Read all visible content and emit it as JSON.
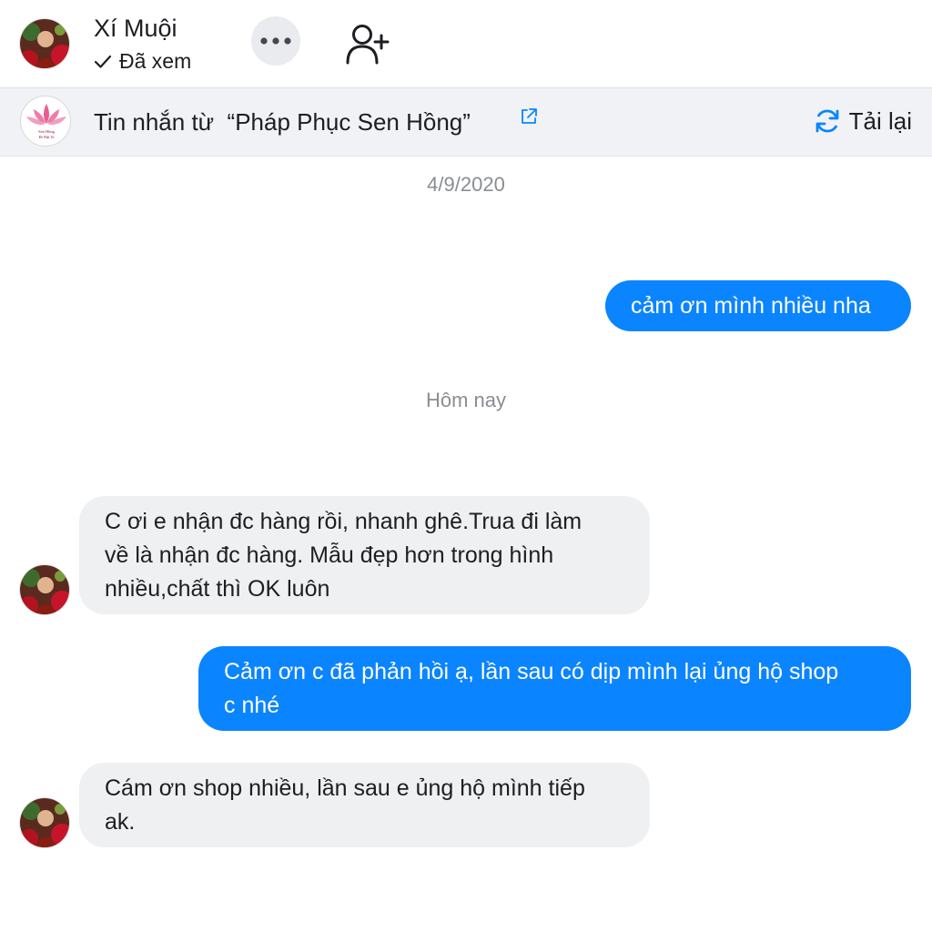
{
  "header": {
    "contact_name": "Xí Muội",
    "seen_status": "Đã xem",
    "icons": {
      "more": "more-horizontal-icon",
      "add_user": "add-user-icon",
      "seen": "checkmark-icon"
    }
  },
  "banner": {
    "prefix": "Tin nhắn từ",
    "page_name": "“Pháp Phục Sen Hồng”",
    "logo_text": [
      "Sen Hồng",
      "Đồ Phật Tử"
    ],
    "reload_label": "Tải lại",
    "icons": {
      "external": "external-link-icon",
      "reload": "reload-icon"
    }
  },
  "colors": {
    "accent": "#0b84ff",
    "incoming_bubble": "#eff0f2",
    "banner_bg": "#f0f2f5",
    "lotus": "#e85d94"
  },
  "conversation": {
    "separators": [
      "4/9/2020",
      "Hôm nay"
    ],
    "messages": [
      {
        "direction": "out",
        "text": "cảm ơn mình nhiều nha"
      },
      {
        "direction": "in",
        "lines": [
          "C ơi e nhận đc hàng rồi, nhanh ghê.Trua đi làm",
          "về là nhận đc hàng. Mẫu đẹp hơn trong hình",
          "nhiều,chất thì OK luôn"
        ]
      },
      {
        "direction": "out",
        "lines": [
          "Cảm ơn c đã phản hồi ạ, lần sau có dịp mình lại ủng hộ shop",
          "c nhé"
        ]
      },
      {
        "direction": "in",
        "lines": [
          "Cám ơn shop nhiều, lần sau e ủng hộ mình tiếp",
          "ak."
        ]
      }
    ]
  }
}
